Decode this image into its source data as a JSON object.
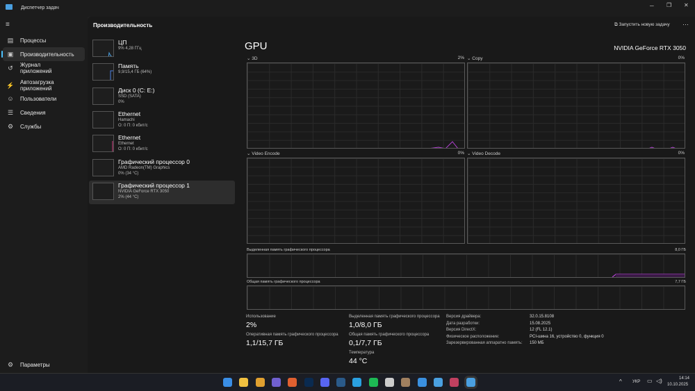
{
  "window": {
    "title": "Диспетчер задач",
    "min": "─",
    "max": "❐",
    "close": "✕"
  },
  "sidebar": {
    "items": [
      {
        "label": "Процессы",
        "icon": "processes-icon",
        "glyph": "▤"
      },
      {
        "label": "Производительность",
        "icon": "performance-icon",
        "glyph": "▣"
      },
      {
        "label": "Журнал приложений",
        "icon": "history-icon",
        "glyph": "↺"
      },
      {
        "label": "Автозагрузка приложений",
        "icon": "startup-icon",
        "glyph": "⚡"
      },
      {
        "label": "Пользователи",
        "icon": "users-icon",
        "glyph": "☺"
      },
      {
        "label": "Сведения",
        "icon": "details-icon",
        "glyph": "☰"
      },
      {
        "label": "Службы",
        "icon": "services-icon",
        "glyph": "⚙"
      }
    ],
    "settings": "Параметры"
  },
  "header": {
    "title": "Производительность",
    "run_task": "Запустить новую задачу",
    "more": "···"
  },
  "devices": [
    {
      "name": "ЦП",
      "sub1": "9% 4,28 ГГц",
      "sub2": ""
    },
    {
      "name": "Память",
      "sub1": "9,9/15,4 ГБ (64%)",
      "sub2": ""
    },
    {
      "name": "Диск 0 (C: E:)",
      "sub1": "SSD (SATA)",
      "sub2": "0%"
    },
    {
      "name": "Ethernet",
      "sub1": "Hamachi",
      "sub2": "О: 0 П: 0 кбит/с"
    },
    {
      "name": "Ethernet",
      "sub1": "Ethernet",
      "sub2": "О: 0 П: 0 кбит/с"
    },
    {
      "name": "Графический процессор 0",
      "sub1": "AMD Radeon(TM) Graphics",
      "sub2": "0% (34 °C)"
    },
    {
      "name": "Графический процессор 1",
      "sub1": "NVIDIA GeForce RTX 3050",
      "sub2": "2% (44 °C)"
    }
  ],
  "gpu": {
    "title": "GPU",
    "model": "NVIDIA GeForce RTX 3050",
    "graphs": [
      {
        "label": "3D",
        "value": "2%"
      },
      {
        "label": "Copy",
        "value": "0%"
      },
      {
        "label": "Video Encode",
        "value": "0%"
      },
      {
        "label": "Video Decode",
        "value": "0%"
      }
    ],
    "dedicated": {
      "label": "Выделенная память графического процессора",
      "max": "8,0 ГБ"
    },
    "shared": {
      "label": "Общая память графического процессора",
      "max": "7,7 ГБ"
    },
    "stats": {
      "usage_label": "Использование",
      "usage": "2%",
      "ram_label": "Оперативная память графического процессора",
      "ram": "1,1/15,7 ГБ",
      "ded_label": "Выделенная память графического процессора",
      "ded": "1,0/8,0 ГБ",
      "shr_label": "Общая память графического процессора",
      "shr": "0,1/7,7 ГБ",
      "temp_label": "Температура",
      "temp": "44 °C"
    },
    "info": [
      {
        "k": "Версия драйвера:",
        "v": "32.0.15.8108"
      },
      {
        "k": "Дата разработки:",
        "v": "15.08.2025"
      },
      {
        "k": "Версия DirectX:",
        "v": "12 (FL 12.1)"
      },
      {
        "k": "Физическое расположение:",
        "v": "PCI-шина 16, устройство 0, функция 0"
      },
      {
        "k": "Зарезервированная аппаратно память:",
        "v": "150 МБ"
      }
    ]
  },
  "taskbar": {
    "lang": "УКР",
    "time": "14:14",
    "date": "10.10.2025"
  },
  "colors": {
    "accent": "#4cc2ff",
    "gpu_line": "#b040d0"
  }
}
